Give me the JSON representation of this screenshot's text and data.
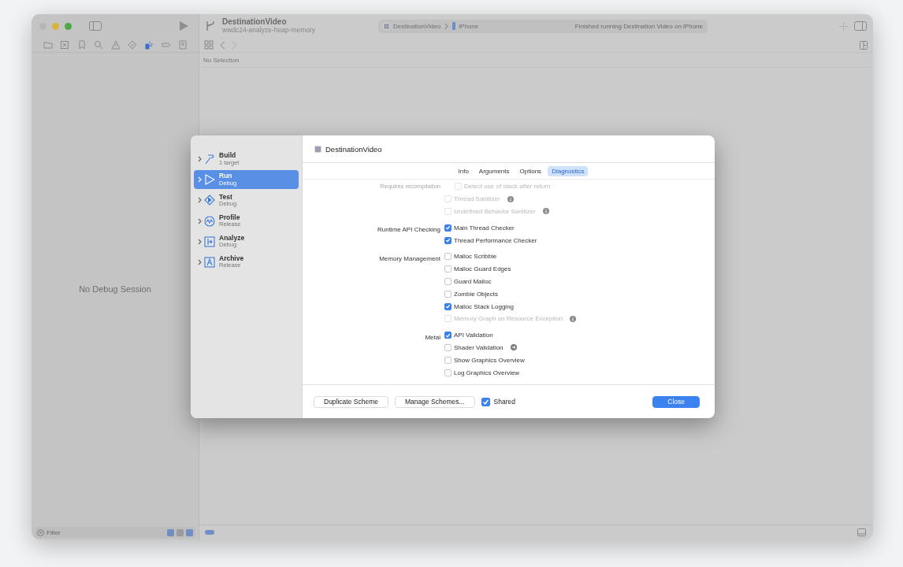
{
  "window": {
    "project": "DestinationVideo",
    "branch": "wwdc24-analyze-heap-memory"
  },
  "activity": {
    "scheme": "DestinationVideo",
    "device": "iPhone",
    "status": "Finished running Destination Video on iPhone"
  },
  "navigator_tabs": [
    {
      "kind": "folder",
      "selected": false
    },
    {
      "kind": "source",
      "selected": false
    },
    {
      "kind": "bookmark",
      "selected": false
    },
    {
      "kind": "search",
      "selected": false
    },
    {
      "kind": "issue",
      "selected": false
    },
    {
      "kind": "test",
      "selected": false
    },
    {
      "kind": "debug",
      "selected": true
    },
    {
      "kind": "breakpoint",
      "selected": false
    },
    {
      "kind": "report",
      "selected": false
    }
  ],
  "editor": {
    "path": "No Selection"
  },
  "debug_area": {
    "message": "No Debug Session"
  },
  "filter": {
    "placeholder": "Filter"
  },
  "dialog": {
    "scheme": "DestinationVideo",
    "actions": [
      {
        "kind": "build",
        "name": "Build",
        "detail": "1 target",
        "selected": false
      },
      {
        "kind": "run",
        "name": "Run",
        "detail": "Debug",
        "selected": true
      },
      {
        "kind": "test",
        "name": "Test",
        "detail": "Debug",
        "selected": false
      },
      {
        "kind": "profile",
        "name": "Profile",
        "detail": "Release",
        "selected": false
      },
      {
        "kind": "analyze",
        "name": "Analyze",
        "detail": "Debug",
        "selected": false
      },
      {
        "kind": "archive",
        "name": "Archive",
        "detail": "Release",
        "selected": false
      }
    ],
    "tabs": [
      {
        "label": "Info",
        "selected": false
      },
      {
        "label": "Arguments",
        "selected": false
      },
      {
        "label": "Options",
        "selected": false
      },
      {
        "label": "Diagnostics",
        "selected": true
      }
    ],
    "sections": [
      {
        "note": "Requires recompilation",
        "options": [
          {
            "label": "Detect use of stack after return",
            "checked": false,
            "disabled": true,
            "kind": "sub",
            "info_button": false,
            "detail_button": false
          },
          {
            "label": "Thread Sanitizer",
            "checked": false,
            "disabled": true,
            "kind": "option",
            "info_button": true,
            "detail_button": false
          },
          {
            "label": "Undefined Behavior Sanitizer",
            "checked": false,
            "disabled": true,
            "kind": "option",
            "info_button": true,
            "detail_button": false
          }
        ]
      },
      {
        "label": "Runtime API Checking",
        "options": [
          {
            "label": "Main Thread Checker",
            "checked": true,
            "disabled": false,
            "kind": "option",
            "info_button": false,
            "detail_button": false
          },
          {
            "label": "Thread Performance Checker",
            "checked": true,
            "disabled": false,
            "kind": "option",
            "info_button": false,
            "detail_button": false
          }
        ]
      },
      {
        "label": "Memory Management",
        "options": [
          {
            "label": "Malloc Scribble",
            "checked": false,
            "disabled": false,
            "kind": "option",
            "info_button": false,
            "detail_button": false
          },
          {
            "label": "Malloc Guard Edges",
            "checked": false,
            "disabled": false,
            "kind": "option",
            "info_button": false,
            "detail_button": false
          },
          {
            "label": "Guard Malloc",
            "checked": false,
            "disabled": false,
            "kind": "option",
            "info_button": false,
            "detail_button": false
          },
          {
            "label": "Zombie Objects",
            "checked": false,
            "disabled": false,
            "kind": "option",
            "info_button": false,
            "detail_button": false
          },
          {
            "label": "Malloc Stack Logging",
            "checked": true,
            "disabled": false,
            "kind": "option",
            "info_button": false,
            "detail_button": false
          },
          {
            "label": "Memory Graph on Resource Exception",
            "checked": false,
            "disabled": true,
            "kind": "option",
            "info_button": true,
            "detail_button": false
          }
        ]
      },
      {
        "label": "Metal",
        "options": [
          {
            "label": "API Validation",
            "checked": true,
            "disabled": false,
            "kind": "option",
            "info_button": false,
            "detail_button": false
          },
          {
            "label": "Shader Validation",
            "checked": false,
            "disabled": false,
            "kind": "option",
            "info_button": false,
            "detail_button": true
          },
          {
            "label": "Show Graphics Overview",
            "checked": false,
            "disabled": false,
            "kind": "option",
            "info_button": false,
            "detail_button": false
          },
          {
            "label": "Log Graphics Overview",
            "checked": false,
            "disabled": false,
            "kind": "option",
            "info_button": false,
            "detail_button": false
          }
        ]
      }
    ],
    "buttons": [
      {
        "label": "Duplicate Scheme",
        "kind": "plain"
      },
      {
        "label": "Manage Schemes...",
        "kind": "plain"
      },
      {
        "label": "Close",
        "kind": "primary"
      }
    ],
    "shared": {
      "label": "Shared",
      "checked": true
    }
  }
}
